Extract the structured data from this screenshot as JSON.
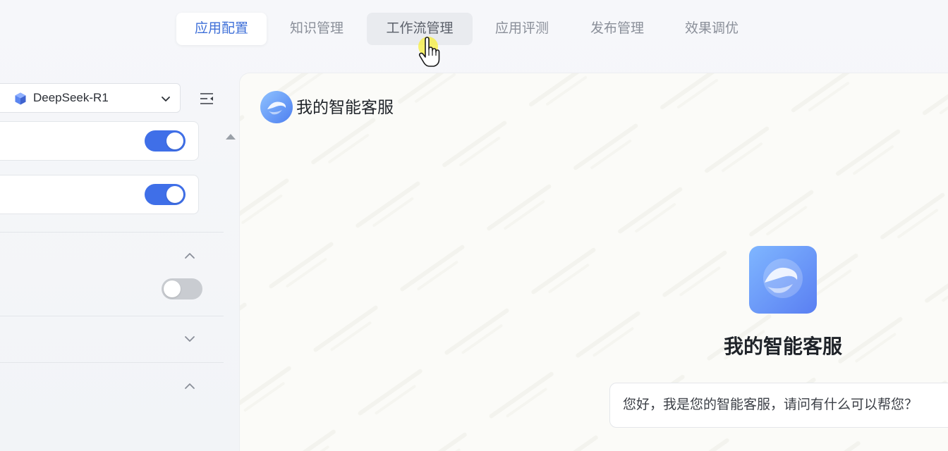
{
  "tabs": [
    {
      "label": "应用配置",
      "state": "active"
    },
    {
      "label": "知识管理",
      "state": "normal"
    },
    {
      "label": "工作流管理",
      "state": "hover"
    },
    {
      "label": "应用评测",
      "state": "normal"
    },
    {
      "label": "发布管理",
      "state": "normal"
    },
    {
      "label": "效果调优",
      "state": "normal"
    }
  ],
  "left_panel": {
    "model_select": {
      "value": "DeepSeek-R1",
      "icon": "cube-icon"
    },
    "collapse_icon": "collapse-panel-icon",
    "toggles": [
      {
        "state": "on"
      },
      {
        "state": "on"
      },
      {
        "state": "off"
      }
    ],
    "sections": [
      {
        "expanded": true
      },
      {
        "expanded": false
      },
      {
        "expanded": true
      }
    ]
  },
  "preview": {
    "header_title": "我的智能客服",
    "center_title": "我的智能客服",
    "greeting": "您好，我是您的智能客服，请问有什么可以帮您？"
  },
  "colors": {
    "accent": "#3e6fd8",
    "toggle_on": "#3f6fe8",
    "toggle_off": "#c9ccd1"
  }
}
